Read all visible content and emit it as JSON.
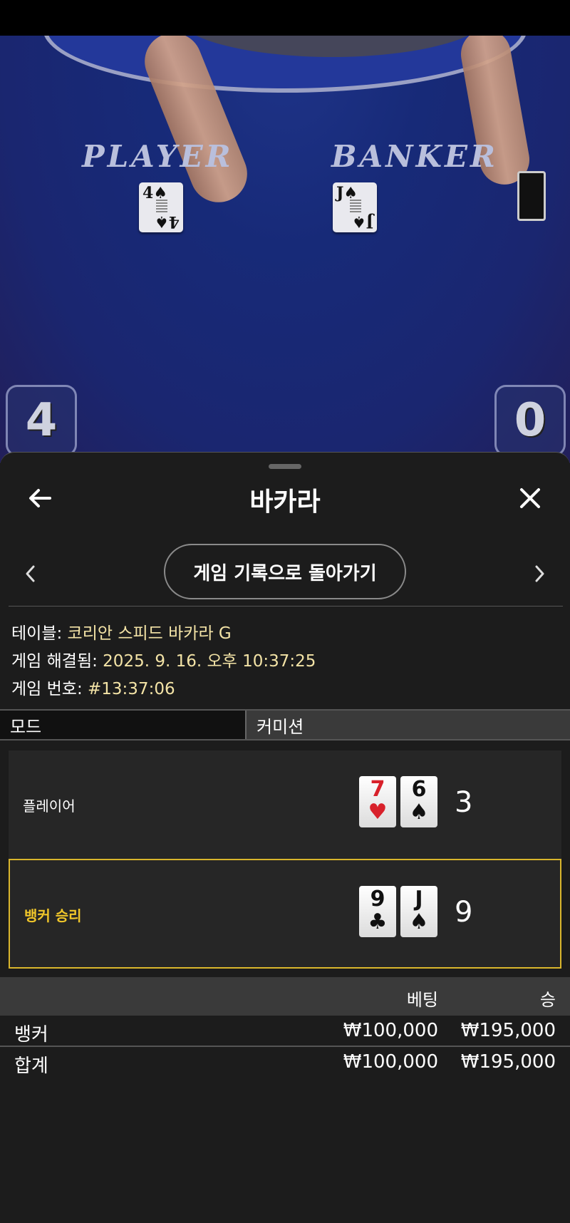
{
  "video": {
    "player_label": "PLAYER",
    "banker_label": "BANKER",
    "player_card": {
      "rank": "4",
      "suit": "♠"
    },
    "banker_card": {
      "rank": "J",
      "suit": "♠"
    },
    "player_score": "4",
    "banker_score": "0"
  },
  "sheet": {
    "title": "바카라",
    "back_button_label": "게임 기록으로 돌아가기",
    "info": {
      "table_label": "테이블: ",
      "table_value": "코리안 스피드 바카라 G",
      "resolved_label": "게임 해결됨: ",
      "resolved_value": "2025. 9. 16. 오후 10:37:25",
      "game_no_label": "게임 번호: ",
      "game_no_value": "#13:37:06"
    },
    "mode": {
      "label": "모드",
      "value": "커미션"
    },
    "hands": [
      {
        "name": "플레이어",
        "cards": [
          {
            "rank": "7",
            "suit": "♥",
            "color": "red"
          },
          {
            "rank": "6",
            "suit": "♠",
            "color": "black"
          }
        ],
        "score": "3",
        "winner": false
      },
      {
        "name": "뱅커 승리",
        "cards": [
          {
            "rank": "9",
            "suit": "♣",
            "color": "black"
          },
          {
            "rank": "J",
            "suit": "♠",
            "color": "black"
          }
        ],
        "score": "9",
        "winner": true
      }
    ],
    "results": {
      "headers": {
        "bet": "베팅",
        "win": "승"
      },
      "rows": [
        {
          "name": "뱅커",
          "bet": "₩100,000",
          "win": "₩195,000"
        },
        {
          "name": "합계",
          "bet": "₩100,000",
          "win": "₩195,000"
        }
      ]
    }
  },
  "colors": {
    "accent_gold": "#d9b52c",
    "info_value": "#f3e3a6",
    "sheet_bg": "#1c1c1c"
  }
}
